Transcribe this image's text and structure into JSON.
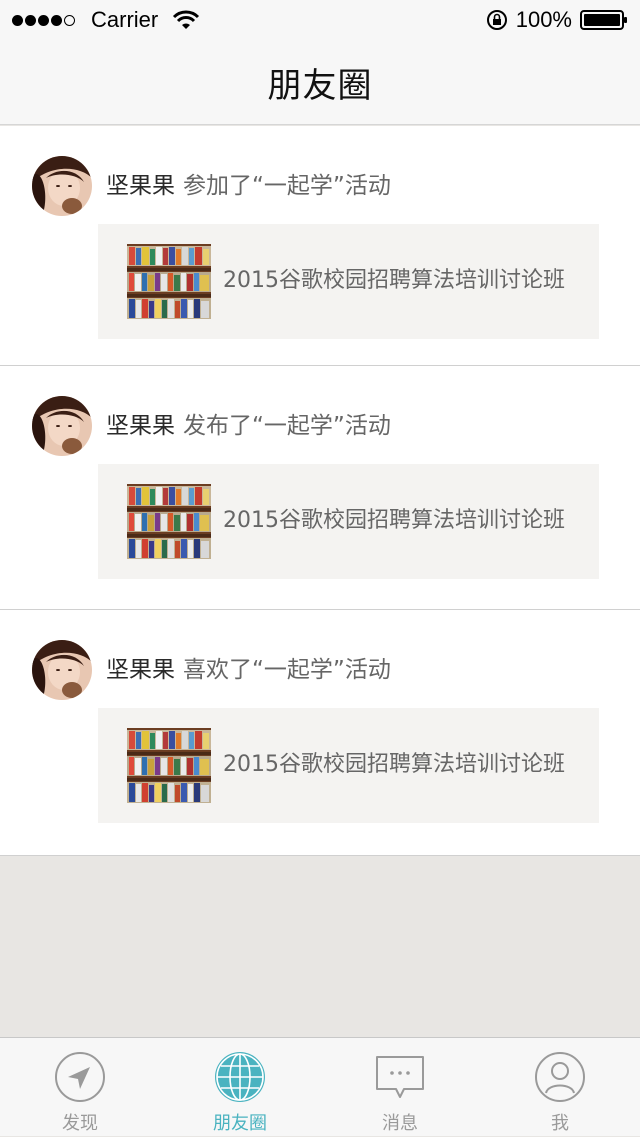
{
  "status_bar": {
    "carrier": "Carrier",
    "battery": "100%",
    "signal_bars_filled": 4,
    "signal_bars_total": 5
  },
  "nav": {
    "title": "朋友圈"
  },
  "feed": [
    {
      "user": "坚果果",
      "action": "参加了“一起学”活动",
      "activity_title": "2015谷歌校园招聘算法培训讨论班"
    },
    {
      "user": "坚果果",
      "action": "发布了“一起学”活动",
      "activity_title": "2015谷歌校园招聘算法培训讨论班"
    },
    {
      "user": "坚果果",
      "action": "喜欢了“一起学”活动",
      "activity_title": "2015谷歌校园招聘算法培训讨论班"
    }
  ],
  "tab_bar": {
    "tabs": [
      {
        "label": "发现",
        "icon": "compass-icon",
        "active": false
      },
      {
        "label": "朋友圈",
        "icon": "globe-icon",
        "active": true
      },
      {
        "label": "消息",
        "icon": "chat-bubble-icon",
        "active": false
      },
      {
        "label": "我",
        "icon": "person-icon",
        "active": false
      }
    ]
  },
  "colors": {
    "accent": "#4ab3c0",
    "inactive": "#9a9a9a",
    "card_bg": "#f4f3f1",
    "page_bg": "#e8e6e3"
  }
}
